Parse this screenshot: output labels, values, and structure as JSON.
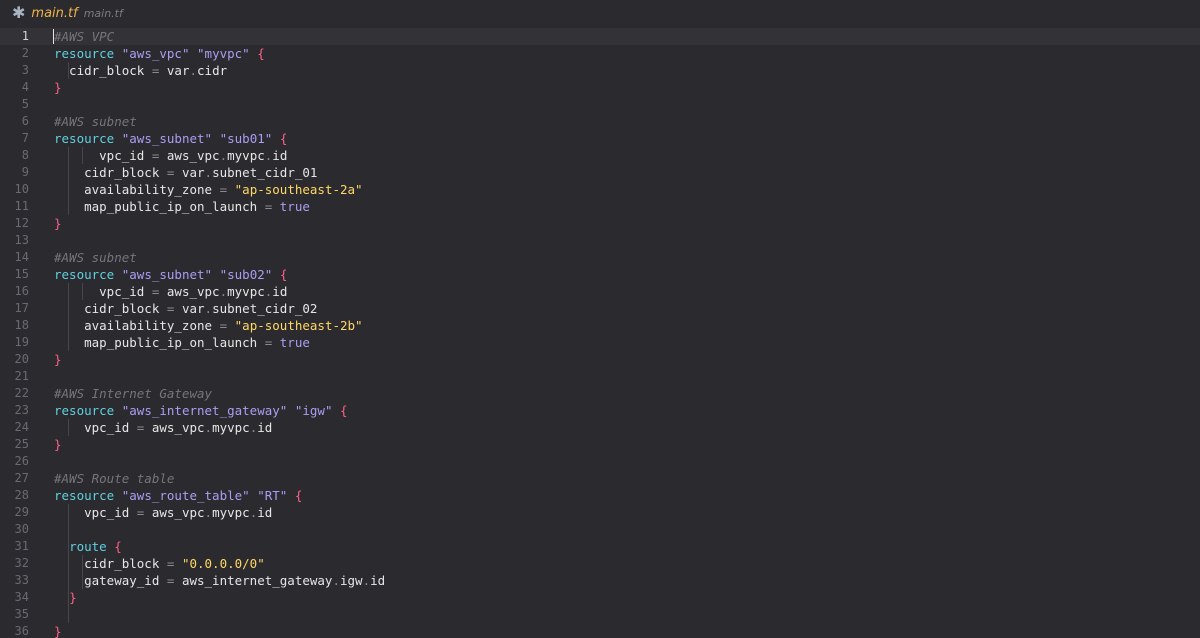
{
  "tab": {
    "icon": "terraform-asterisk-icon",
    "icon_glyph": "✱",
    "title": "main.tf",
    "description": "main.tf"
  },
  "editor": {
    "current_line": 1,
    "lines": [
      {
        "n": "1",
        "indent": 0,
        "tokens": [
          {
            "c": "cm",
            "t": "#AWS VPC"
          }
        ]
      },
      {
        "n": "2",
        "indent": 0,
        "tokens": [
          {
            "c": "kw",
            "t": "resource"
          },
          {
            "c": "id",
            "t": " "
          },
          {
            "c": "str",
            "t": "\"aws_vpc\""
          },
          {
            "c": "id",
            "t": " "
          },
          {
            "c": "str",
            "t": "\"myvpc\""
          },
          {
            "c": "id",
            "t": " "
          },
          {
            "c": "pun",
            "t": "{"
          }
        ]
      },
      {
        "n": "3",
        "indent": 1,
        "tokens": [
          {
            "c": "id",
            "t": "  cidr_block "
          },
          {
            "c": "op",
            "t": "="
          },
          {
            "c": "id",
            "t": " var"
          },
          {
            "c": "op",
            "t": "."
          },
          {
            "c": "id",
            "t": "cidr"
          }
        ]
      },
      {
        "n": "4",
        "indent": 0,
        "tokens": [
          {
            "c": "pun",
            "t": "}"
          }
        ]
      },
      {
        "n": "5",
        "indent": 0,
        "tokens": []
      },
      {
        "n": "6",
        "indent": 0,
        "tokens": [
          {
            "c": "cm",
            "t": "#AWS subnet"
          }
        ]
      },
      {
        "n": "7",
        "indent": 0,
        "tokens": [
          {
            "c": "kw",
            "t": "resource"
          },
          {
            "c": "id",
            "t": " "
          },
          {
            "c": "str",
            "t": "\"aws_subnet\""
          },
          {
            "c": "id",
            "t": " "
          },
          {
            "c": "str",
            "t": "\"sub01\""
          },
          {
            "c": "id",
            "t": " "
          },
          {
            "c": "pun",
            "t": "{"
          }
        ]
      },
      {
        "n": "8",
        "indent": 2,
        "tokens": [
          {
            "c": "id",
            "t": "      vpc_id "
          },
          {
            "c": "op",
            "t": "="
          },
          {
            "c": "id",
            "t": " aws_vpc"
          },
          {
            "c": "op",
            "t": "."
          },
          {
            "c": "id",
            "t": "myvpc"
          },
          {
            "c": "op",
            "t": "."
          },
          {
            "c": "id",
            "t": "id"
          }
        ]
      },
      {
        "n": "9",
        "indent": 1,
        "tokens": [
          {
            "c": "id",
            "t": "    cidr_block "
          },
          {
            "c": "op",
            "t": "="
          },
          {
            "c": "id",
            "t": " var"
          },
          {
            "c": "op",
            "t": "."
          },
          {
            "c": "id",
            "t": "subnet_cidr_01"
          }
        ]
      },
      {
        "n": "10",
        "indent": 1,
        "tokens": [
          {
            "c": "id",
            "t": "    availability_zone "
          },
          {
            "c": "op",
            "t": "="
          },
          {
            "c": "id",
            "t": " "
          },
          {
            "c": "ystr",
            "t": "\"ap-southeast-2a\""
          }
        ]
      },
      {
        "n": "11",
        "indent": 1,
        "tokens": [
          {
            "c": "id",
            "t": "    map_public_ip_on_launch "
          },
          {
            "c": "op",
            "t": "="
          },
          {
            "c": "id",
            "t": " "
          },
          {
            "c": "bool",
            "t": "true"
          }
        ]
      },
      {
        "n": "12",
        "indent": 0,
        "tokens": [
          {
            "c": "pun",
            "t": "}"
          }
        ]
      },
      {
        "n": "13",
        "indent": 0,
        "tokens": []
      },
      {
        "n": "14",
        "indent": 0,
        "tokens": [
          {
            "c": "cm",
            "t": "#AWS subnet"
          }
        ]
      },
      {
        "n": "15",
        "indent": 0,
        "tokens": [
          {
            "c": "kw",
            "t": "resource"
          },
          {
            "c": "id",
            "t": " "
          },
          {
            "c": "str",
            "t": "\"aws_subnet\""
          },
          {
            "c": "id",
            "t": " "
          },
          {
            "c": "str",
            "t": "\"sub02\""
          },
          {
            "c": "id",
            "t": " "
          },
          {
            "c": "pun",
            "t": "{"
          }
        ]
      },
      {
        "n": "16",
        "indent": 2,
        "tokens": [
          {
            "c": "id",
            "t": "      vpc_id "
          },
          {
            "c": "op",
            "t": "="
          },
          {
            "c": "id",
            "t": " aws_vpc"
          },
          {
            "c": "op",
            "t": "."
          },
          {
            "c": "id",
            "t": "myvpc"
          },
          {
            "c": "op",
            "t": "."
          },
          {
            "c": "id",
            "t": "id"
          }
        ]
      },
      {
        "n": "17",
        "indent": 1,
        "tokens": [
          {
            "c": "id",
            "t": "    cidr_block "
          },
          {
            "c": "op",
            "t": "="
          },
          {
            "c": "id",
            "t": " var"
          },
          {
            "c": "op",
            "t": "."
          },
          {
            "c": "id",
            "t": "subnet_cidr_02"
          }
        ]
      },
      {
        "n": "18",
        "indent": 1,
        "tokens": [
          {
            "c": "id",
            "t": "    availability_zone "
          },
          {
            "c": "op",
            "t": "="
          },
          {
            "c": "id",
            "t": " "
          },
          {
            "c": "ystr",
            "t": "\"ap-southeast-2b\""
          }
        ]
      },
      {
        "n": "19",
        "indent": 1,
        "tokens": [
          {
            "c": "id",
            "t": "    map_public_ip_on_launch "
          },
          {
            "c": "op",
            "t": "="
          },
          {
            "c": "id",
            "t": " "
          },
          {
            "c": "bool",
            "t": "true"
          }
        ]
      },
      {
        "n": "20",
        "indent": 0,
        "tokens": [
          {
            "c": "pun",
            "t": "}"
          }
        ]
      },
      {
        "n": "21",
        "indent": 0,
        "tokens": []
      },
      {
        "n": "22",
        "indent": 0,
        "tokens": [
          {
            "c": "cm",
            "t": "#AWS Internet Gateway"
          }
        ]
      },
      {
        "n": "23",
        "indent": 0,
        "tokens": [
          {
            "c": "kw",
            "t": "resource"
          },
          {
            "c": "id",
            "t": " "
          },
          {
            "c": "str",
            "t": "\"aws_internet_gateway\""
          },
          {
            "c": "id",
            "t": " "
          },
          {
            "c": "str",
            "t": "\"igw\""
          },
          {
            "c": "id",
            "t": " "
          },
          {
            "c": "pun",
            "t": "{"
          }
        ]
      },
      {
        "n": "24",
        "indent": 1,
        "tokens": [
          {
            "c": "id",
            "t": "    vpc_id "
          },
          {
            "c": "op",
            "t": "="
          },
          {
            "c": "id",
            "t": " aws_vpc"
          },
          {
            "c": "op",
            "t": "."
          },
          {
            "c": "id",
            "t": "myvpc"
          },
          {
            "c": "op",
            "t": "."
          },
          {
            "c": "id",
            "t": "id"
          }
        ]
      },
      {
        "n": "25",
        "indent": 0,
        "tokens": [
          {
            "c": "pun",
            "t": "}"
          }
        ]
      },
      {
        "n": "26",
        "indent": 0,
        "tokens": []
      },
      {
        "n": "27",
        "indent": 0,
        "tokens": [
          {
            "c": "cm",
            "t": "#AWS Route table"
          }
        ]
      },
      {
        "n": "28",
        "indent": 0,
        "tokens": [
          {
            "c": "kw",
            "t": "resource"
          },
          {
            "c": "id",
            "t": " "
          },
          {
            "c": "str",
            "t": "\"aws_route_table\""
          },
          {
            "c": "id",
            "t": " "
          },
          {
            "c": "str",
            "t": "\"RT\""
          },
          {
            "c": "id",
            "t": " "
          },
          {
            "c": "pun",
            "t": "{"
          }
        ]
      },
      {
        "n": "29",
        "indent": 1,
        "tokens": [
          {
            "c": "id",
            "t": "    vpc_id "
          },
          {
            "c": "op",
            "t": "="
          },
          {
            "c": "id",
            "t": " aws_vpc"
          },
          {
            "c": "op",
            "t": "."
          },
          {
            "c": "id",
            "t": "myvpc"
          },
          {
            "c": "op",
            "t": "."
          },
          {
            "c": "id",
            "t": "id"
          }
        ]
      },
      {
        "n": "30",
        "indent": 1,
        "tokens": []
      },
      {
        "n": "31",
        "indent": 1,
        "tokens": [
          {
            "c": "id",
            "t": "  "
          },
          {
            "c": "kw",
            "t": "route"
          },
          {
            "c": "id",
            "t": " "
          },
          {
            "c": "pun",
            "t": "{"
          }
        ]
      },
      {
        "n": "32",
        "indent": 2,
        "tokens": [
          {
            "c": "id",
            "t": "    cidr_block "
          },
          {
            "c": "op",
            "t": "="
          },
          {
            "c": "id",
            "t": " "
          },
          {
            "c": "ystr",
            "t": "\"0.0.0.0/0\""
          }
        ]
      },
      {
        "n": "33",
        "indent": 2,
        "tokens": [
          {
            "c": "id",
            "t": "    gateway_id "
          },
          {
            "c": "op",
            "t": "="
          },
          {
            "c": "id",
            "t": " aws_internet_gateway"
          },
          {
            "c": "op",
            "t": "."
          },
          {
            "c": "id",
            "t": "igw"
          },
          {
            "c": "op",
            "t": "."
          },
          {
            "c": "id",
            "t": "id"
          }
        ]
      },
      {
        "n": "34",
        "indent": 1,
        "tokens": [
          {
            "c": "id",
            "t": "  "
          },
          {
            "c": "pun",
            "t": "}"
          }
        ]
      },
      {
        "n": "35",
        "indent": 1,
        "tokens": []
      },
      {
        "n": "36",
        "indent": 0,
        "tokens": [
          {
            "c": "pun",
            "t": "}"
          }
        ]
      }
    ]
  }
}
